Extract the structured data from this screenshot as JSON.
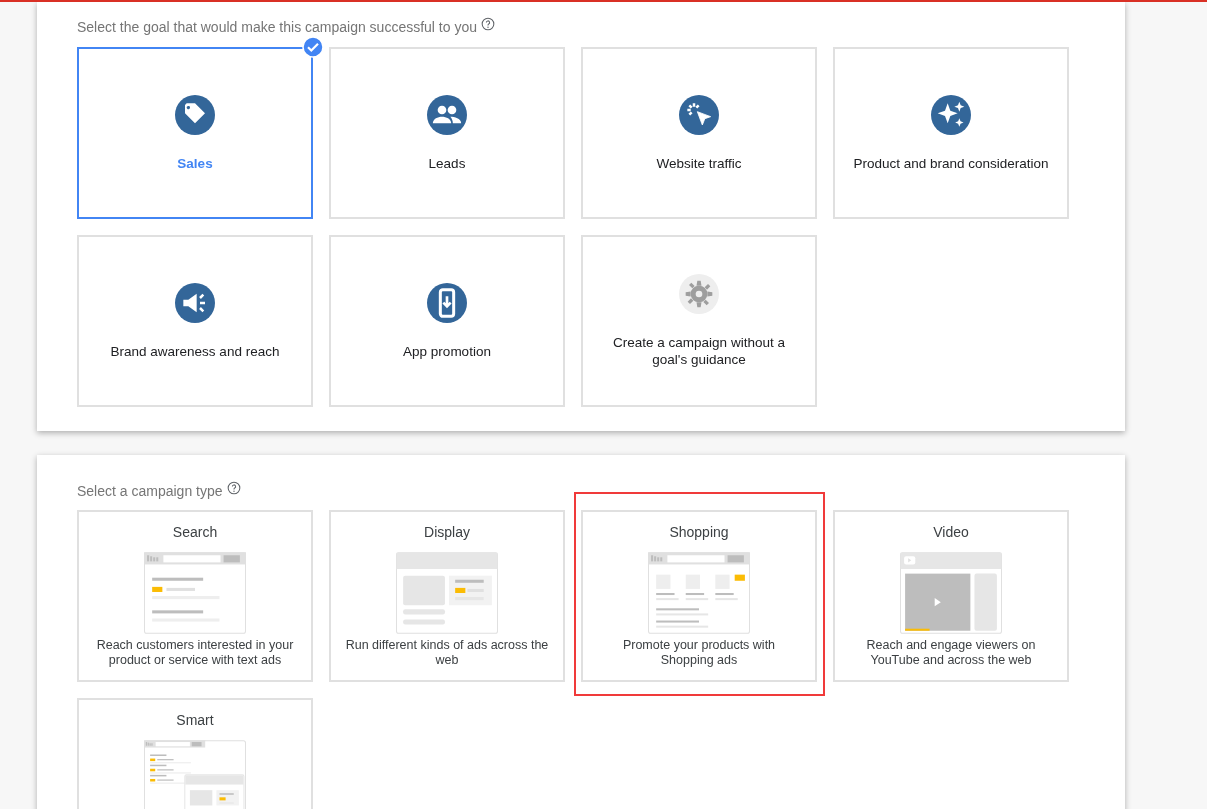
{
  "goal_section": {
    "prompt": "Select the goal that would make this campaign successful to you",
    "goals": [
      {
        "label": "Sales",
        "selected": true
      },
      {
        "label": "Leads",
        "selected": false
      },
      {
        "label": "Website traffic",
        "selected": false
      },
      {
        "label": "Product and brand consideration",
        "selected": false
      },
      {
        "label": "Brand awareness and reach",
        "selected": false
      },
      {
        "label": "App promotion",
        "selected": false
      },
      {
        "label": "Create a campaign without a goal's guidance",
        "selected": false
      }
    ]
  },
  "type_section": {
    "prompt": "Select a campaign type",
    "types": [
      {
        "title": "Search",
        "description": "Reach customers interested in your product or service with text ads",
        "highlighted": false
      },
      {
        "title": "Display",
        "description": "Run different kinds of ads across the web",
        "highlighted": false
      },
      {
        "title": "Shopping",
        "description": "Promote your products with Shopping ads",
        "highlighted": true
      },
      {
        "title": "Video",
        "description": "Reach and engage viewers on YouTube and across the web",
        "highlighted": false
      },
      {
        "title": "Smart",
        "highlighted": false
      }
    ]
  }
}
